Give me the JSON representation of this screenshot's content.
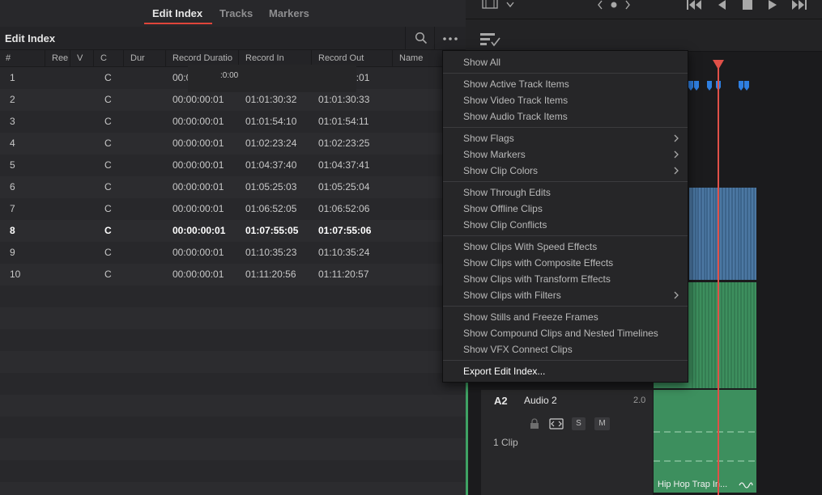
{
  "tabs": [
    "Edit Index",
    "Tracks",
    "Markers"
  ],
  "panel_title": "Edit Index",
  "columns": [
    "#",
    "Ree",
    "V",
    "C",
    "Dur",
    "Record Duratio",
    "Record In",
    "Record Out",
    "Name"
  ],
  "rows": [
    {
      "num": "1",
      "c": "C",
      "duration": "00:00:00:01",
      "record_in": "01:00:00:00",
      "record_out": "01:00:00:01"
    },
    {
      "num": "2",
      "c": "C",
      "duration": "00:00:00:01",
      "record_in": "01:01:30:32",
      "record_out": "01:01:30:33"
    },
    {
      "num": "3",
      "c": "C",
      "duration": "00:00:00:01",
      "record_in": "01:01:54:10",
      "record_out": "01:01:54:11"
    },
    {
      "num": "4",
      "c": "C",
      "duration": "00:00:00:01",
      "record_in": "01:02:23:24",
      "record_out": "01:02:23:25"
    },
    {
      "num": "5",
      "c": "C",
      "duration": "00:00:00:01",
      "record_in": "01:04:37:40",
      "record_out": "01:04:37:41"
    },
    {
      "num": "6",
      "c": "C",
      "duration": "00:00:00:01",
      "record_in": "01:05:25:03",
      "record_out": "01:05:25:04"
    },
    {
      "num": "7",
      "c": "C",
      "duration": "00:00:00:01",
      "record_in": "01:06:52:05",
      "record_out": "01:06:52:06"
    },
    {
      "num": "8",
      "c": "C",
      "duration": "00:00:00:01",
      "record_in": "01:07:55:05",
      "record_out": "01:07:55:06"
    },
    {
      "num": "9",
      "c": "C",
      "duration": "00:00:00:01",
      "record_in": "01:10:35:23",
      "record_out": "01:10:35:24"
    },
    {
      "num": "10",
      "c": "C",
      "duration": "00:00:00:01",
      "record_in": "01:11:20:56",
      "record_out": "01:11:20:57"
    }
  ],
  "selected_row": "8",
  "menu": {
    "groups": [
      [
        {
          "label": "Show All"
        }
      ],
      [
        {
          "label": "Show Active Track Items"
        },
        {
          "label": "Show Video Track Items"
        },
        {
          "label": "Show Audio Track Items"
        }
      ],
      [
        {
          "label": "Show Flags",
          "submenu": true
        },
        {
          "label": "Show Markers",
          "submenu": true
        },
        {
          "label": "Show Clip Colors",
          "submenu": true
        }
      ],
      [
        {
          "label": "Show Through Edits"
        },
        {
          "label": "Show Offline Clips"
        },
        {
          "label": "Show Clip Conflicts"
        }
      ],
      [
        {
          "label": "Show Clips With Speed Effects"
        },
        {
          "label": "Show Clips with Composite Effects"
        },
        {
          "label": "Show Clips with Transform Effects"
        },
        {
          "label": "Show Clips with Filters",
          "submenu": true
        }
      ],
      [
        {
          "label": "Show Stills and Freeze Frames"
        },
        {
          "label": "Show Compound Clips and Nested Timelines"
        },
        {
          "label": "Show VFX Connect Clips"
        }
      ],
      [
        {
          "label": "Export Edit Index...",
          "emphasis": true
        }
      ]
    ]
  },
  "timeline": {
    "ruler_timecode": ":0:00",
    "audio2": {
      "id": "A2",
      "name": "Audio 2",
      "channels": "2.0",
      "buttons": [
        "S",
        "M"
      ],
      "clip_count": "1 Clip",
      "clip_name": "Hip Hop Trap In..."
    }
  },
  "colors": {
    "accent_red": "#e0453a",
    "video_clip": "#4c78a3",
    "audio_clip": "#3d8f5e",
    "marker_blue": "#2f7fe0"
  },
  "icons": [
    "search-icon",
    "more-icon",
    "film-strip-icon",
    "chevron-down-icon",
    "prev-icon",
    "dot-icon",
    "next-icon",
    "skip-back-icon",
    "step-back-icon",
    "stop-icon",
    "play-icon",
    "skip-forward-icon",
    "timeline-options-icon",
    "lock-icon",
    "auto-track-icon",
    "waveform-icon",
    "chevron-right-icon"
  ]
}
